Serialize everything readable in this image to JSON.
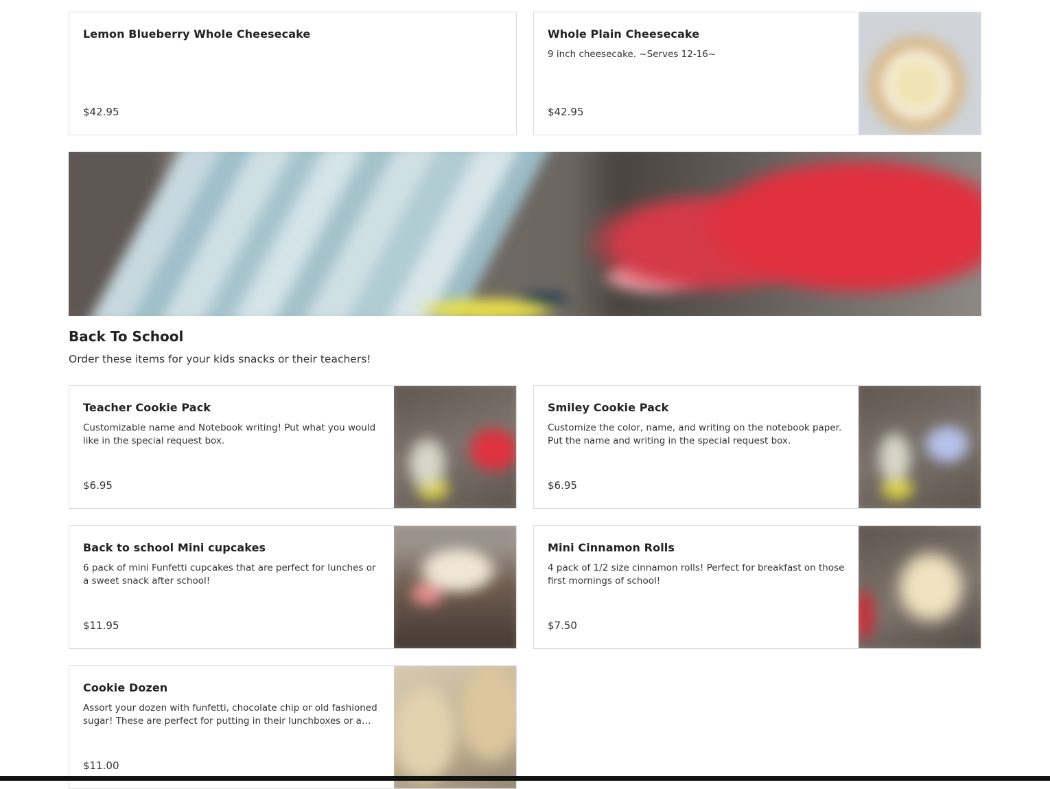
{
  "top_items": [
    {
      "name": "Lemon Blueberry Whole Cheesecake",
      "description": "",
      "price": "$42.95"
    },
    {
      "name": "Whole Plain Cheesecake",
      "description": "9 inch cheesecake. ~Serves 12-16~",
      "price": "$42.95"
    }
  ],
  "section": {
    "title": "Back To School",
    "description": "Order these items for your kids snacks or their teachers!"
  },
  "items": [
    {
      "name": "Teacher Cookie Pack",
      "description": "Customizable name and Notebook writing! Put what you would like in the special request box.",
      "price": "$6.95"
    },
    {
      "name": "Smiley Cookie Pack",
      "description": "Customize the color, name, and writing on the notebook paper. Put the name and writing in the special request box.",
      "price": "$6.95"
    },
    {
      "name": "Back to school Mini cupcakes",
      "description": "6 pack of mini Funfetti cupcakes that are perfect for lunches or a sweet snack after school!",
      "price": "$11.95"
    },
    {
      "name": "Mini Cinnamon Rolls",
      "description": "4 pack of 1/2 size cinnamon rolls! Perfect for breakfast on those first mornings of school!",
      "price": "$7.50"
    },
    {
      "name": "Cookie Dozen",
      "description": "Assort your dozen with funfetti, chocolate chip or old fashioned sugar! These are perfect for putting in their lunchboxes or a quick…",
      "price": "$11.00"
    }
  ]
}
